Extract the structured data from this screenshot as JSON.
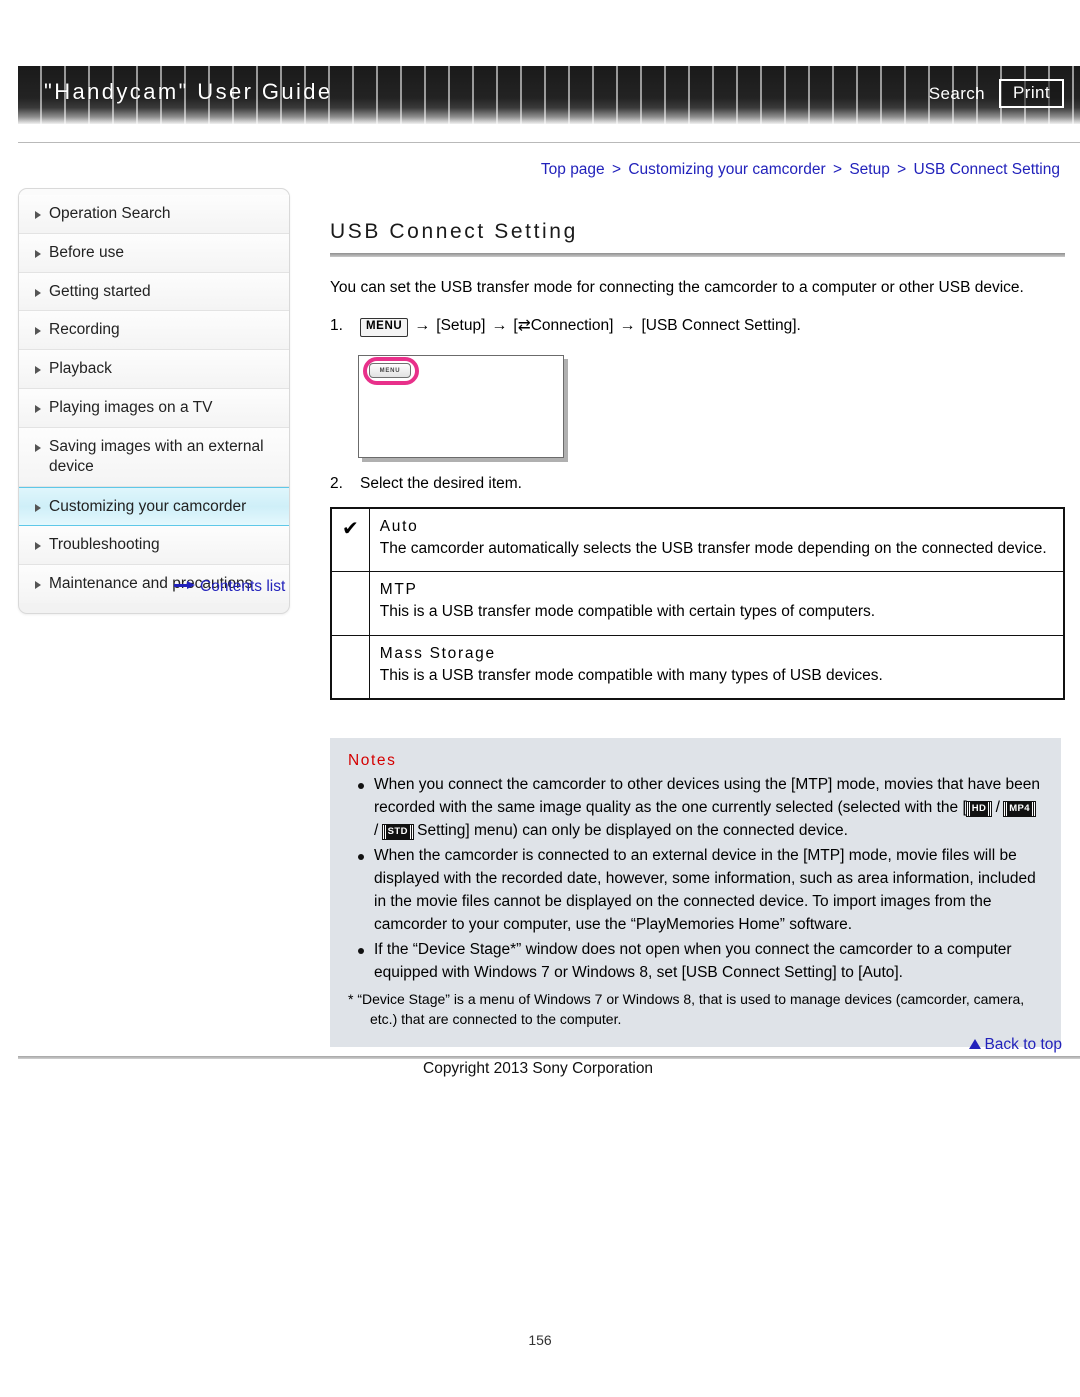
{
  "header": {
    "title": "\"Handycam\" User Guide",
    "search_label": "Search",
    "print_label": "Print"
  },
  "breadcrumb": {
    "items": [
      "Top page",
      "Customizing your camcorder",
      "Setup",
      "USB Connect Setting"
    ],
    "separator": ">"
  },
  "sidebar": {
    "items": [
      {
        "label": "Operation Search",
        "active": false
      },
      {
        "label": "Before use",
        "active": false
      },
      {
        "label": "Getting started",
        "active": false
      },
      {
        "label": "Recording",
        "active": false
      },
      {
        "label": "Playback",
        "active": false
      },
      {
        "label": "Playing images on a TV",
        "active": false
      },
      {
        "label": "Saving images with an external device",
        "active": false
      },
      {
        "label": "Customizing your camcorder",
        "active": true
      },
      {
        "label": "Troubleshooting",
        "active": false
      },
      {
        "label": "Maintenance and precautions",
        "active": false
      }
    ],
    "contents_link": "Contents list",
    "active_color": "#cfeff8",
    "active_border": "#5ec8e8"
  },
  "main": {
    "title": "USB Connect Setting",
    "intro": "You can set the USB transfer mode for connecting the camcorder to a computer or other USB device.",
    "step1": {
      "number": "1.",
      "menu_chip": "MENU",
      "arrow": "→",
      "part_setup": "[Setup]",
      "connection_icon": "⇄",
      "part_connection": "Connection]",
      "connection_open": "[",
      "part_final": "[USB Connect Setting]."
    },
    "device_shot": {
      "menu_button_label": "MENU",
      "highlight_color": "#e8308a"
    },
    "step2": {
      "number": "2.",
      "text": "Select the desired item."
    },
    "options": [
      {
        "checked": true,
        "check_glyph": "✔",
        "name": "Auto",
        "description": "The camcorder automatically selects the USB transfer mode depending on the connected device."
      },
      {
        "checked": false,
        "check_glyph": "",
        "name": "MTP",
        "description": "This is a USB transfer mode compatible with certain types of computers."
      },
      {
        "checked": false,
        "check_glyph": "",
        "name": "Mass Storage",
        "description": "This is a USB transfer mode compatible with many types of USB devices."
      }
    ],
    "notes": {
      "title": "Notes",
      "title_color": "#d40000",
      "badges": {
        "hd": "HD",
        "mp4": "MP4",
        "std": "STD"
      },
      "items": [
        {
          "segments": [
            {
              "type": "text",
              "value": "When you connect the camcorder to other devices using the [MTP] mode, movies that have been recorded with the same image quality as the one currently selected (selected with the ["
            },
            {
              "type": "badge",
              "value": "HD"
            },
            {
              "type": "text",
              "value": " / "
            },
            {
              "type": "badge",
              "value": "MP4"
            },
            {
              "type": "text",
              "value": " / "
            },
            {
              "type": "badge",
              "value": "STD"
            },
            {
              "type": "text",
              "value": " Setting] menu) can only be displayed on the connected device."
            }
          ]
        },
        {
          "segments": [
            {
              "type": "text",
              "value": "When the camcorder is connected to an external device in the [MTP] mode, movie files will be displayed with the recorded date, however, some information, such as area information, included in the movie files cannot be displayed on the connected device. To import images from the camcorder to your computer, use the “PlayMemories Home” software."
            }
          ]
        },
        {
          "segments": [
            {
              "type": "text",
              "value": "If the “Device Stage*” window does not open when you connect the camcorder to a computer equipped with Windows 7 or Windows 8, set [USB Connect Setting] to [Auto]."
            }
          ]
        }
      ],
      "footnote_line1": "* “Device Stage” is a menu of Windows 7 or Windows 8, that is used to manage devices (camcorder, camera,",
      "footnote_line2": "etc.) that are connected to the computer."
    }
  },
  "footer": {
    "back_to_top": "Back to top",
    "copyright": "Copyright 2013 Sony Corporation",
    "page_number": "156"
  }
}
